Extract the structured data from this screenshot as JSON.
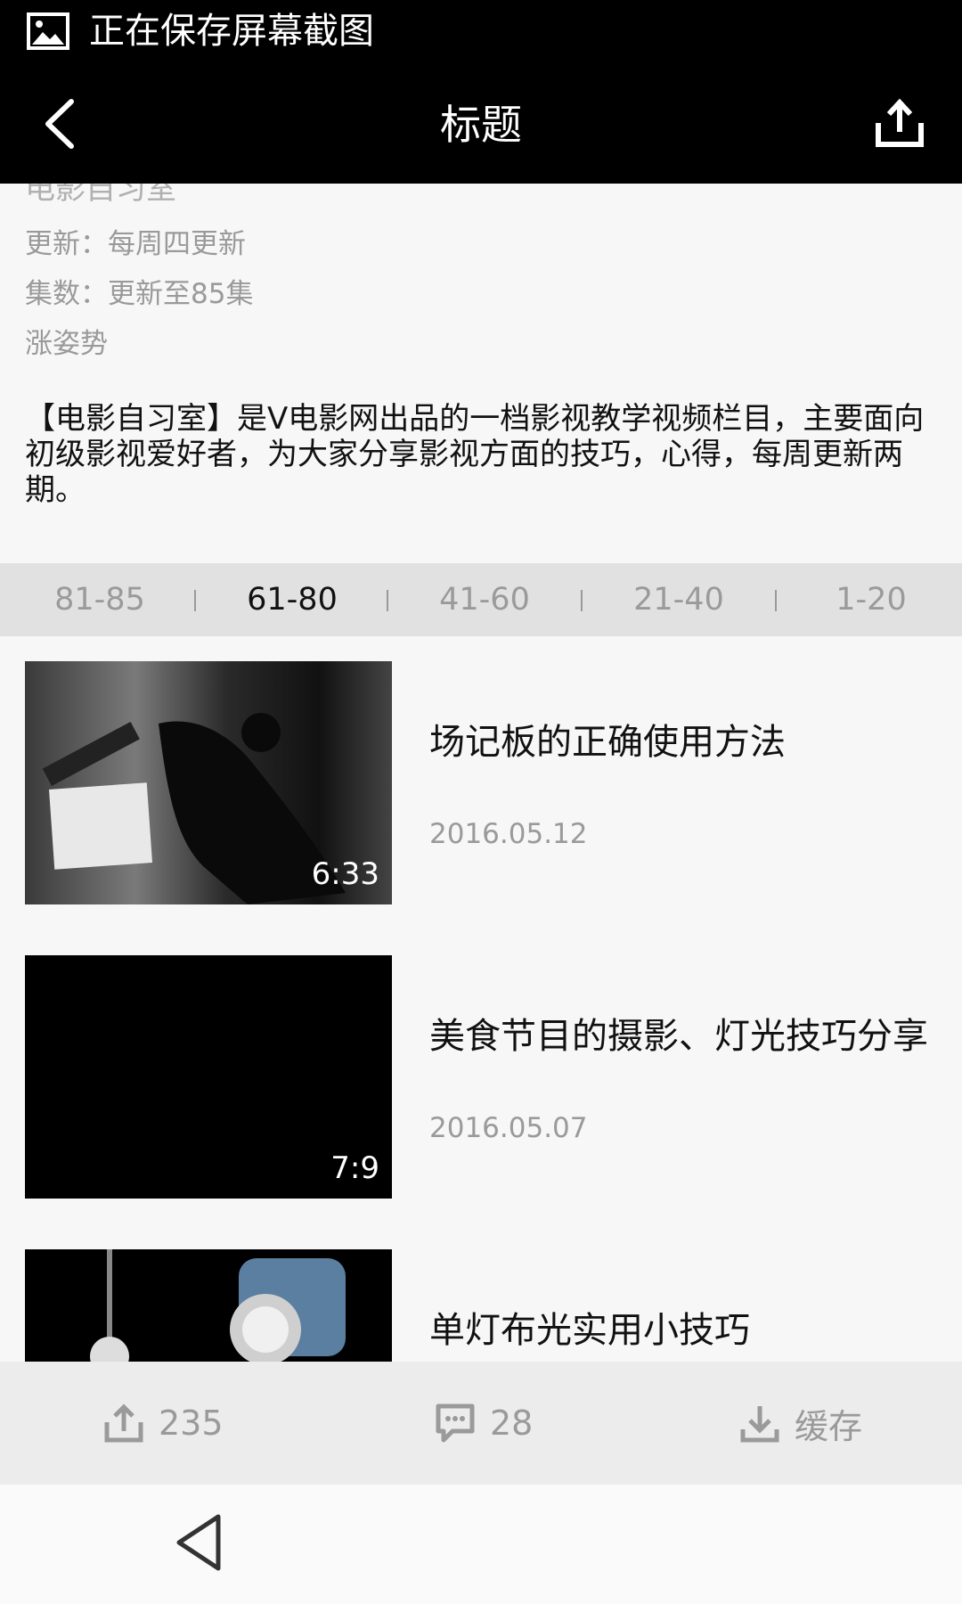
{
  "status_bar": {
    "text": "正在保存屏幕截图",
    "icon": "image-icon"
  },
  "app_bar": {
    "title": "标题",
    "back_icon": "chevron-left-icon",
    "share_icon": "share-icon"
  },
  "show_info": {
    "partial_name": "电影自习室",
    "update": "更新：每周四更新",
    "episodes": "集数：更新至85集",
    "subtitle": "涨姿势",
    "description": "【电影自习室】是V电影网出品的一档影视教学视频栏目，主要面向初级影视爱好者，为大家分享影视方面的技巧，心得，每周更新两期。"
  },
  "episode_tabs": [
    {
      "label": "81-85",
      "active": false
    },
    {
      "label": "61-80",
      "active": true
    },
    {
      "label": "41-60",
      "active": false
    },
    {
      "label": "21-40",
      "active": false
    },
    {
      "label": "1-20",
      "active": false
    }
  ],
  "videos": [
    {
      "title": "场记板的正确使用方法",
      "date": "2016.05.12",
      "duration": "6:33"
    },
    {
      "title": "美食节目的摄影、灯光技巧分享",
      "date": "2016.05.07",
      "duration": "7:9"
    },
    {
      "title": "单灯布光实用小技巧",
      "date": "",
      "duration": ""
    }
  ],
  "bottom_bar": {
    "share_count": "235",
    "comment_count": "28",
    "download_label": "缓存"
  },
  "colors": {
    "bar_bg": "#000000",
    "tab_bg": "#e1e1e1",
    "muted_text": "#9a9a9a",
    "bottom_bg": "#ececec"
  }
}
